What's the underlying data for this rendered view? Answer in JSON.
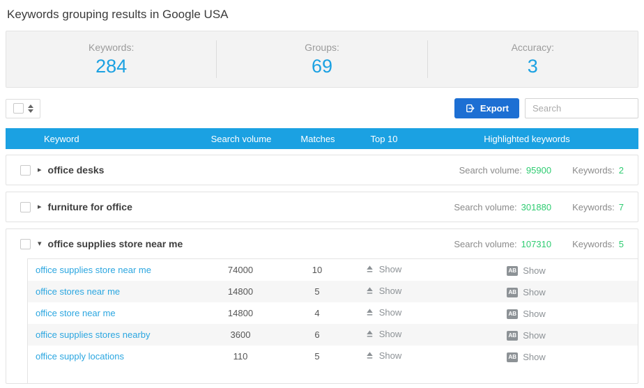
{
  "page": {
    "title": "Keywords grouping results in Google USA"
  },
  "stats": [
    {
      "label": "Keywords:",
      "value": "284"
    },
    {
      "label": "Groups:",
      "value": "69"
    },
    {
      "label": "Accuracy:",
      "value": "3"
    }
  ],
  "toolbar": {
    "export_label": "Export",
    "search_placeholder": "Search"
  },
  "table": {
    "columns": [
      "Keyword",
      "Search volume",
      "Matches",
      "Top 10",
      "Highlighted keywords"
    ]
  },
  "labels": {
    "search_volume": "Search volume:",
    "keywords": "Keywords:",
    "show": "Show"
  },
  "icons": {
    "collapsed": "▸",
    "expanded": "▾",
    "ab_badge": "AB"
  },
  "colors": {
    "header_blue": "#1ba1e2",
    "export_blue": "#1d6fd3",
    "link_blue": "#2ba6e0",
    "value_green": "#2ecc71"
  },
  "groups": [
    {
      "name": "office desks",
      "expanded": false,
      "search_volume": "95900",
      "keywords_count": "2"
    },
    {
      "name": "furniture for office",
      "expanded": false,
      "search_volume": "301880",
      "keywords_count": "7"
    },
    {
      "name": "office supplies store near me",
      "expanded": true,
      "search_volume": "107310",
      "keywords_count": "5",
      "rows": [
        {
          "keyword": "office supplies store near me",
          "search_volume": "74000",
          "matches": "10"
        },
        {
          "keyword": "office stores near me",
          "search_volume": "14800",
          "matches": "5"
        },
        {
          "keyword": "office store near me",
          "search_volume": "14800",
          "matches": "4"
        },
        {
          "keyword": "office supplies stores nearby",
          "search_volume": "3600",
          "matches": "6"
        },
        {
          "keyword": "office supply locations",
          "search_volume": "110",
          "matches": "5"
        }
      ]
    }
  ]
}
